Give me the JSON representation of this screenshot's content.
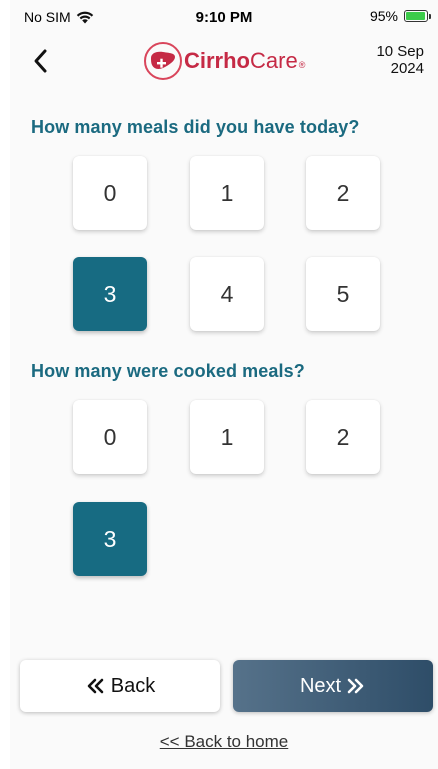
{
  "status_bar": {
    "carrier": "No SIM",
    "wifi_icon": "wifi-icon",
    "time": "9:10 PM",
    "battery_percent": "95%",
    "battery_level": 0.95,
    "battery_icon": "battery-charging-icon"
  },
  "header": {
    "back_icon": "chevron-left-icon",
    "logo": {
      "part1": "Cirrho",
      "part2": "Care",
      "reg": "®",
      "icon": "liver-plus-icon"
    },
    "date_day_month": "10 Sep",
    "date_year": "2024"
  },
  "questions": [
    {
      "text": "How many meals did you have today?",
      "options": [
        "0",
        "1",
        "2",
        "3",
        "4",
        "5"
      ],
      "selected": "3"
    },
    {
      "text": "How many were cooked meals?",
      "options": [
        "0",
        "1",
        "2",
        "3"
      ],
      "selected": "3"
    }
  ],
  "footer": {
    "back_label": "Back",
    "next_label": "Next",
    "home_link": "<< Back to home"
  },
  "colors": {
    "accent": "#176b82",
    "brand": "#c52a45",
    "next_button_start": "#56728a",
    "next_button_end": "#2e4d68"
  }
}
